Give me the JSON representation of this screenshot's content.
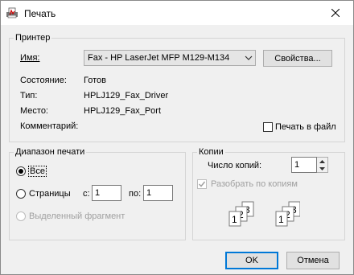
{
  "window": {
    "title": "Печать"
  },
  "printer": {
    "legend": "Принтер",
    "name_label": "Имя:",
    "name_value": "Fax - HP LaserJet MFP M129-M134",
    "properties_button": "Свойства...",
    "status_label": "Состояние:",
    "status_value": "Готов",
    "type_label": "Тип:",
    "type_value": "HPLJ129_Fax_Driver",
    "location_label": "Место:",
    "location_value": "HPLJ129_Fax_Port",
    "comment_label": "Комментарий:",
    "print_to_file_label": "Печать в файл",
    "print_to_file_checked": false
  },
  "range": {
    "legend": "Диапазон печати",
    "all_label": "Все",
    "pages_label": "Страницы",
    "from_label": "с:",
    "from_value": "1",
    "to_label": "по:",
    "to_value": "1",
    "selection_label": "Выделенный фрагмент",
    "selected_option": "all"
  },
  "copies": {
    "legend": "Копии",
    "count_label": "Число копий:",
    "count_value": "1",
    "collate_label": "Разобрать по копиям",
    "collate_checked": true,
    "collate_enabled": false,
    "page_digits": [
      "1",
      "2",
      "3"
    ]
  },
  "footer": {
    "ok_button": "OK",
    "cancel_button": "Отмена"
  },
  "icons": {
    "app": "printer-app-icon",
    "close": "close-icon",
    "dropdown": "chevron-down-icon",
    "spin_up": "spin-up-icon",
    "spin_down": "spin-down-icon",
    "collate": "collate-pages-icon"
  },
  "colors": {
    "accent": "#0078d7",
    "dialog_bg": "#f0f0f0",
    "title_bg": "#ffffff"
  }
}
